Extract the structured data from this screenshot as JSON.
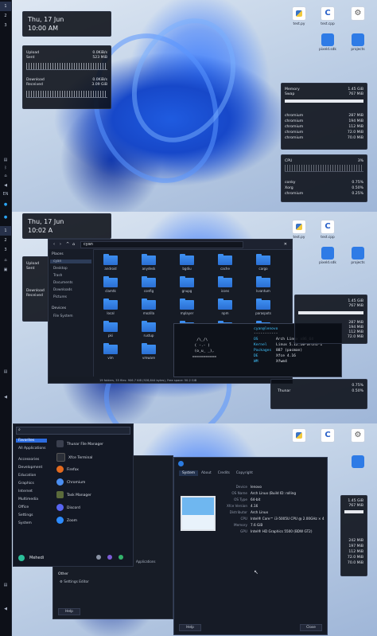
{
  "panels": [
    {
      "clock": {
        "date": "Thu, 17 Jun",
        "time": "10:00 AM"
      },
      "workspaces": [
        "1",
        "2",
        "3"
      ],
      "tray": {
        "lang": "EN"
      },
      "net": {
        "upload": {
          "label": "Upload",
          "value": "0.0KiB/s"
        },
        "sent": {
          "label": "Sent",
          "value": "523 MiB"
        },
        "download": {
          "label": "Download",
          "value": "0.0KiB/s"
        },
        "received": {
          "label": "Received",
          "value": "3.09 GiB"
        }
      },
      "mem": {
        "memory": {
          "label": "Memory",
          "value": "1.45 GiB"
        },
        "swap": {
          "label": "Swap",
          "value": "767 MiB"
        },
        "procs": [
          {
            "name": "chromium",
            "value": "287 MiB"
          },
          {
            "name": "chromium",
            "value": "194 MiB"
          },
          {
            "name": "chromium",
            "value": "112 MiB"
          },
          {
            "name": "chromium",
            "value": "72.0 MiB"
          },
          {
            "name": "chromium",
            "value": "70.0 MiB"
          }
        ]
      },
      "cpu": {
        "label": "CPU",
        "value": "3%",
        "procs": [
          {
            "name": "conky",
            "value": "0.75%"
          },
          {
            "name": "Xorg",
            "value": "0.50%"
          },
          {
            "name": "chromium",
            "value": "0.25%"
          }
        ]
      },
      "desktop_icons": [
        {
          "label": "test.py",
          "icon": "python-icon"
        },
        {
          "label": "test.cpp",
          "icon": "cpp-icon"
        },
        {
          "label": "",
          "icon": "gear-icon"
        },
        {
          "label": "pixeld.sdk",
          "icon": "file-icon"
        },
        {
          "label": "projects",
          "icon": "folder-icon"
        }
      ]
    },
    {
      "clock": {
        "date": "Thu, 17 Jun",
        "time": "10:02 A"
      },
      "workspaces": [
        "1",
        "2",
        "3"
      ],
      "net": {
        "upload": {
          "label": "Upload"
        },
        "sent": {
          "label": "Sent"
        },
        "download": {
          "label": "Download"
        },
        "received": {
          "label": "Received"
        }
      },
      "file_manager": {
        "path": "cyan",
        "places_header": "Places",
        "places": [
          "cyan",
          "Desktop",
          "Trash",
          "Documents",
          "Downloads",
          "Pictures"
        ],
        "devices_header": "Devices",
        "devices": [
          "File System"
        ],
        "folders": [
          "android",
          "anydesk",
          "bgdiu",
          "cache",
          "cargo",
          "clamtk",
          "config",
          "gnupg",
          "icons",
          "kvantum",
          "local",
          "mozilla",
          "mplayer",
          "npm",
          "paraspots",
          "pki",
          "rustup",
          "ssh",
          "themes",
          "thumbnails",
          "vim",
          "vmware"
        ],
        "status": "19 folders, 35 files: 906.7 KiB (928,644 bytes), Free space: 50.2 GiB"
      },
      "neofetch": {
        "user": "cyan@lenovo",
        "sep": "-----------",
        "ascii": [
          "   /\\_/\\",
          "  ( -.- )",
          "  (o_u_ _),",
          " ==========="
        ],
        "rows": [
          {
            "k": "OS",
            "v": "Arch Linux x86_64"
          },
          {
            "k": "Kernel",
            "v": "Linux 5.12.10-arch1-1"
          },
          {
            "k": "Packages",
            "v": "887 (pacman)"
          },
          {
            "k": "DE",
            "v": "Xfce 4.16"
          },
          {
            "k": "WM",
            "v": "Xfwm4"
          }
        ]
      },
      "mem": {
        "memory": {
          "value": "1.45 GiB"
        },
        "swap": {
          "value": "767 MiB"
        },
        "procs": [
          "287 MiB",
          "194 MiB",
          "112 MiB",
          "72.0 MiB",
          "70.0 MiB"
        ]
      },
      "cpu_tail": [
        "0.75%",
        "0.50%"
      ],
      "thunar": "Thunar",
      "desktop_icons": [
        {
          "label": "test.py"
        },
        {
          "label": "test.cpp"
        },
        {
          "label": "pixeld.sdk"
        },
        {
          "label": "projects"
        }
      ]
    },
    {
      "menu": {
        "search_placeholder": "",
        "categories": [
          "Favorites",
          "All Applications",
          "Accessories",
          "Development",
          "Education",
          "Graphics",
          "Internet",
          "Multimedia",
          "Office",
          "Settings",
          "System"
        ],
        "apps": [
          {
            "name": "Thunar File Manager",
            "color": "#3a3f4e"
          },
          {
            "name": "Xfce Terminal",
            "color": "#2b2f38"
          },
          {
            "name": "Firefox",
            "color": "#e36a1e"
          },
          {
            "name": "Chromium",
            "color": "#4b8ef0"
          },
          {
            "name": "Task Manager",
            "color": "#5b6b3b"
          },
          {
            "name": "Discord",
            "color": "#5865f2"
          },
          {
            "name": "Zoom",
            "color": "#2d8cff"
          }
        ],
        "user": "Mehedi"
      },
      "settings_bg": {
        "other": "Other",
        "editor": "Settings Editor",
        "help": "Help",
        "apps_hint": "Applications"
      },
      "about": {
        "tabs": [
          "System",
          "About",
          "Credits",
          "Copyright"
        ],
        "fields": [
          {
            "k": "Device",
            "v": "lenovo"
          },
          {
            "k": "OS Name",
            "v": "Arch Linux (Build ID: rolling"
          },
          {
            "k": "OS Type",
            "v": "64-bit"
          },
          {
            "k": "Xfce Version",
            "v": "4.16"
          },
          {
            "k": "Distributor",
            "v": "Arch Linux"
          },
          {
            "k": "CPU",
            "v": "Intel® Core™ i3-5005U CPU @ 2.00GHz × 4"
          },
          {
            "k": "Memory",
            "v": "7.6 GiB"
          },
          {
            "k": "GPU",
            "v": "Intel® HD Graphics 5500 (BDW GT2)"
          }
        ],
        "help": "Help",
        "close": "Close"
      },
      "mem_right": [
        "1.45 GiB",
        "767 MiB",
        "242 MiB",
        "197 MiB",
        "112 MiB",
        "72.0 MiB",
        "70.0 MiB"
      ]
    }
  ]
}
